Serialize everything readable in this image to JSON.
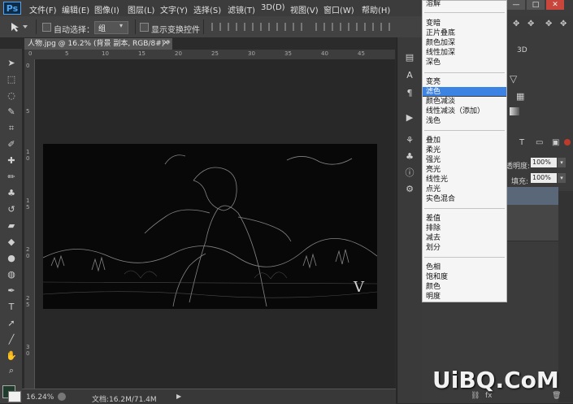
{
  "app": {
    "logo": "Ps",
    "window_buttons": [
      "—",
      "□",
      "✕"
    ]
  },
  "menu": [
    "文件(F)",
    "编辑(E)",
    "图像(I)",
    "图层(L)",
    "文字(Y)",
    "选择(S)",
    "滤镜(T)",
    "3D(D)",
    "视图(V)",
    "窗口(W)",
    "帮助(H)"
  ],
  "options_bar": {
    "auto_select_label": "自动选择：",
    "auto_select_value": "组",
    "show_transform_label": "显示变换控件"
  },
  "document": {
    "tab_title": "人物.jpg @ 16.2% (背景 副本, RGB/8#) *",
    "close_glyph": "×",
    "ruler_top_ticks": [
      "0",
      "5",
      "10",
      "15",
      "20",
      "25",
      "30",
      "35",
      "40",
      "45"
    ],
    "ruler_left_ticks": [
      "0",
      "5",
      "1\n0",
      "1\n5",
      "2\n0",
      "2\n5",
      "3\n0"
    ],
    "watermark_letter": "V"
  },
  "status": {
    "zoom": "16.24%",
    "doc_info": "文档:16.2M/71.4M"
  },
  "right_panel": {
    "tab_3d": "3D",
    "opacity_label": "透明度:",
    "opacity_value": "100%",
    "fill_label": "填充:",
    "fill_value": "100%"
  },
  "blend_menu": {
    "items": [
      {
        "label": "溶解",
        "highlighted": false
      },
      {
        "label": "变暗",
        "highlighted": false
      },
      {
        "label": "正片叠底",
        "highlighted": false
      },
      {
        "label": "颜色加深",
        "highlighted": false
      },
      {
        "label": "线性加深",
        "highlighted": false
      },
      {
        "label": "深色",
        "highlighted": false
      },
      {
        "label": "变亮",
        "highlighted": false
      },
      {
        "label": "滤色",
        "highlighted": true
      },
      {
        "label": "颜色减淡",
        "highlighted": false
      },
      {
        "label": "线性减淡（添加）",
        "highlighted": false
      },
      {
        "label": "浅色",
        "highlighted": false
      },
      {
        "label": "叠加",
        "highlighted": false
      },
      {
        "label": "柔光",
        "highlighted": false
      },
      {
        "label": "强光",
        "highlighted": false
      },
      {
        "label": "亮光",
        "highlighted": false
      },
      {
        "label": "线性光",
        "highlighted": false
      },
      {
        "label": "点光",
        "highlighted": false
      },
      {
        "label": "实色混合",
        "highlighted": false
      },
      {
        "label": "差值",
        "highlighted": false
      },
      {
        "label": "排除",
        "highlighted": false
      },
      {
        "label": "减去",
        "highlighted": false
      },
      {
        "label": "划分",
        "highlighted": false
      },
      {
        "label": "色相",
        "highlighted": false
      },
      {
        "label": "饱和度",
        "highlighted": false
      },
      {
        "label": "颜色",
        "highlighted": false
      },
      {
        "label": "明度",
        "highlighted": false
      }
    ],
    "highlight_color": "#3d83e3"
  },
  "watermark": "UiBQ.CoM",
  "colors": {
    "foreground": "#1f3b2c",
    "background": "#f0f0f0"
  }
}
